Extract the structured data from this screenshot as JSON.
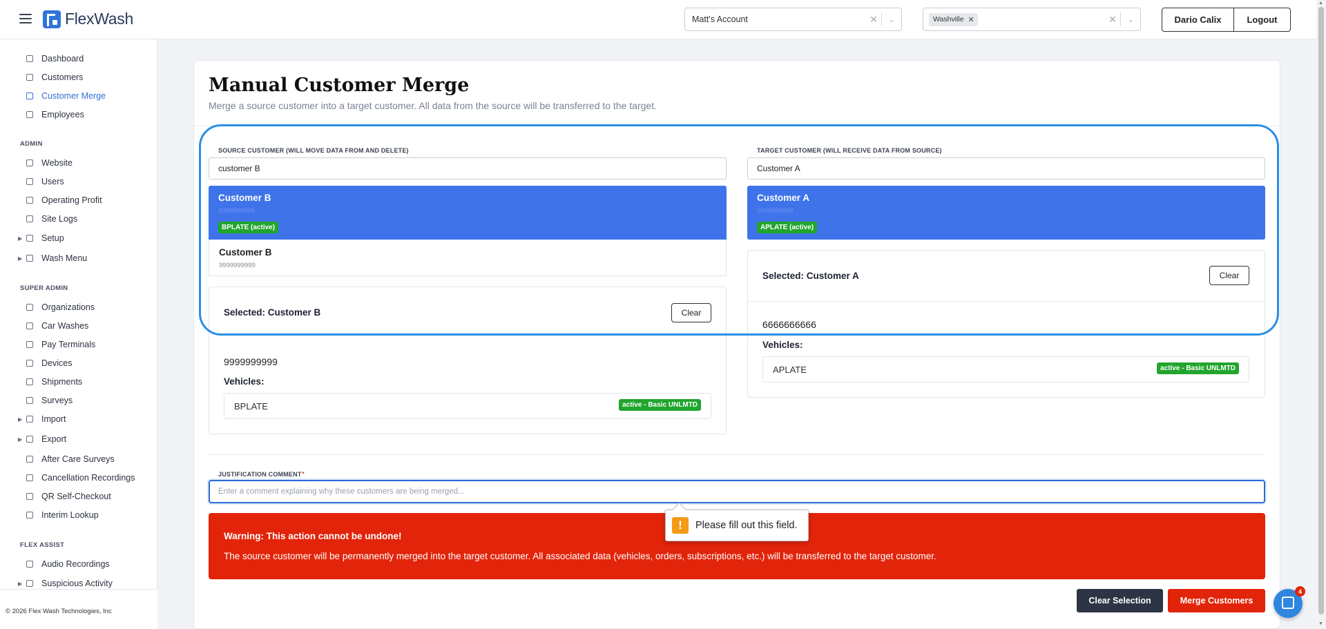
{
  "app": {
    "name": "FlexWash"
  },
  "header": {
    "account_select": "Matt's Account",
    "location_chip": "Washville",
    "user_button": "Dario Calix",
    "logout_button": "Logout"
  },
  "sidebar": {
    "main_items": [
      "Dashboard",
      "Customers",
      "Customer Merge",
      "Employees"
    ],
    "admin_title": "ADMIN",
    "admin_items": [
      "Website",
      "Users",
      "Operating Profit",
      "Site Logs",
      "Setup",
      "Wash Menu"
    ],
    "super_admin_title": "SUPER ADMIN",
    "super_admin_items": [
      "Organizations",
      "Car Washes",
      "Pay Terminals",
      "Devices",
      "Shipments",
      "Surveys",
      "Import",
      "Export",
      "After Care Surveys",
      "Cancellation Recordings",
      "QR Self-Checkout",
      "Interim Lookup"
    ],
    "flex_assist_title": "FLEX ASSIST",
    "flex_assist_items": [
      "Audio Recordings",
      "Suspicious Activity"
    ],
    "footer": "© 2026 Flex Wash Technologies, Inc"
  },
  "page": {
    "title": "Manual Customer Merge",
    "subtitle": "Merge a source customer into a target customer. All data from the source will be transferred to the target."
  },
  "source": {
    "label": "SOURCE CUSTOMER (WILL MOVE DATA FROM AND DELETE)",
    "search_value": "customer B",
    "results": [
      {
        "name": "Customer B",
        "phone": "9999999999",
        "badge": "BPLATE (active)"
      },
      {
        "name": "Customer B",
        "phone": "9999999999"
      }
    ],
    "selected_title": "Selected: Customer B",
    "clear": "Clear",
    "phone": "9999999999",
    "vehicles_label": "Vehicles:",
    "vehicle_plate": "BPLATE",
    "vehicle_status": "active - Basic UNLMTD"
  },
  "target": {
    "label": "TARGET CUSTOMER (WILL RECEIVE DATA FROM SOURCE)",
    "search_value": "Customer A",
    "results": [
      {
        "name": "Customer A",
        "phone": "6666666666",
        "badge": "APLATE (active)"
      }
    ],
    "selected_title": "Selected: Customer A",
    "clear": "Clear",
    "phone": "6666666666",
    "vehicles_label": "Vehicles:",
    "vehicle_plate": "APLATE",
    "vehicle_status": "active - Basic UNLMTD"
  },
  "justification": {
    "label": "JUSTIFICATION COMMENT",
    "required_mark": "*",
    "placeholder": "Enter a comment explaining why these customers are being merged...",
    "validation_tooltip": "Please fill out this field."
  },
  "warning": {
    "title": "Warning: This action cannot be undone!",
    "body": "The source customer will be permanently merged into the target customer. All associated data (vehicles, orders, subscriptions, etc.) will be transferred to the target customer."
  },
  "actions": {
    "clear_selection": "Clear Selection",
    "merge": "Merge Customers"
  },
  "chat": {
    "unread_count": "4"
  },
  "colors": {
    "primary_blue": "#3e73ea",
    "danger_red": "#e2240a",
    "success_green": "#21a52d",
    "highlight_ring": "#2a8ee6"
  }
}
